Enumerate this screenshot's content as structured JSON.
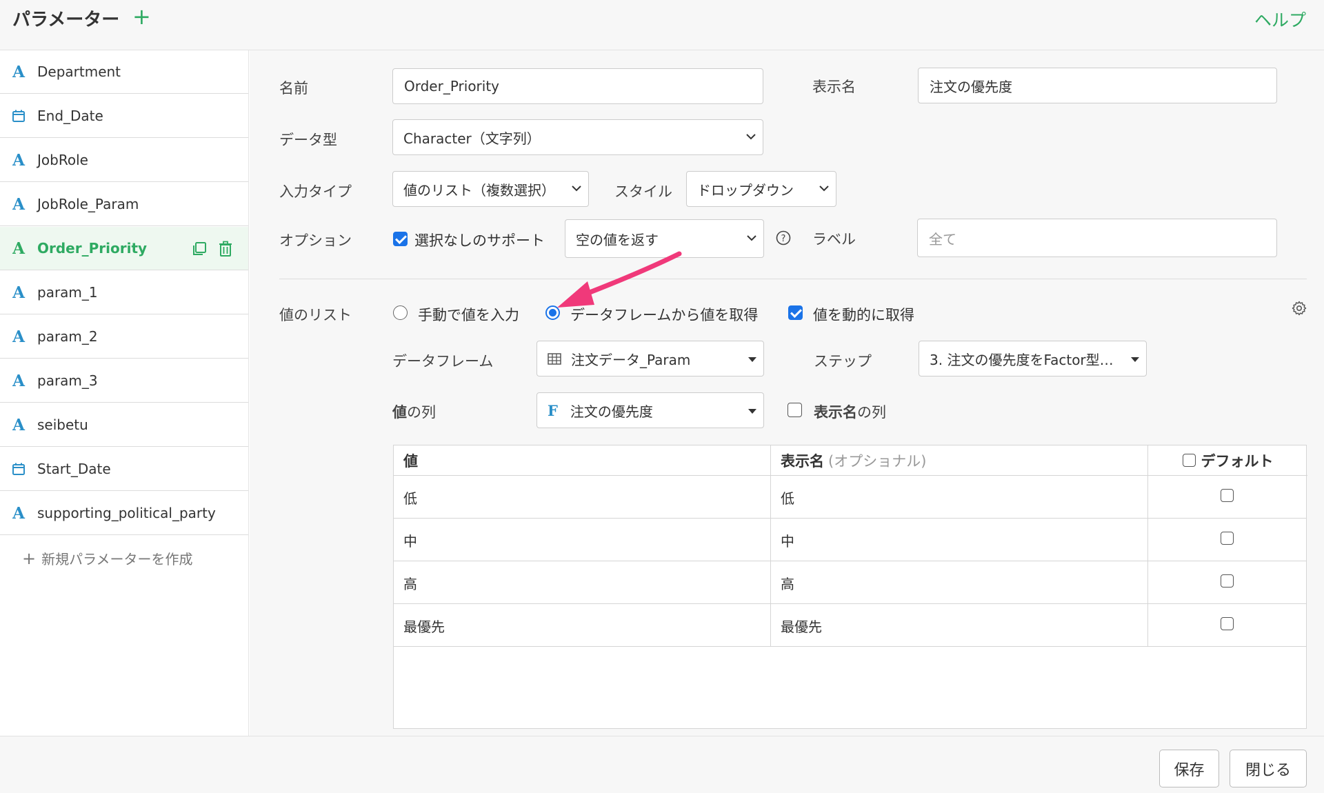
{
  "header": {
    "title": "パラメーター",
    "help": "ヘルプ"
  },
  "sidebar": {
    "items": [
      {
        "label": "Department",
        "type": "A"
      },
      {
        "label": "End_Date",
        "type": "calendar"
      },
      {
        "label": "JobRole",
        "type": "A"
      },
      {
        "label": "JobRole_Param",
        "type": "A"
      },
      {
        "label": "Order_Priority",
        "type": "A",
        "active": true
      },
      {
        "label": "param_1",
        "type": "A"
      },
      {
        "label": "param_2",
        "type": "A"
      },
      {
        "label": "param_3",
        "type": "A"
      },
      {
        "label": "seibetu",
        "type": "A"
      },
      {
        "label": "Start_Date",
        "type": "calendar"
      },
      {
        "label": "supporting_political_party",
        "type": "A"
      }
    ],
    "new_param": "新規パラメーターを作成"
  },
  "form": {
    "name_label": "名前",
    "name_value": "Order_Priority",
    "display_name_label": "表示名",
    "display_name_value": "注文の優先度",
    "datatype_label": "データ型",
    "datatype_value": "Character（文字列）",
    "input_type_label": "入力タイプ",
    "input_type_value": "値のリスト（複数選択）",
    "style_label": "スタイル",
    "style_value": "ドロップダウン",
    "option_label": "オプション",
    "no_selection_label": "選択なしのサポート",
    "no_selection_checked": true,
    "empty_value_select": "空の値を返す",
    "label_label": "ラベル",
    "label_placeholder": "全て"
  },
  "values": {
    "list_label": "値のリスト",
    "manual_label": "手動で値を入力",
    "dataframe_radio_label": "データフレームから値を取得",
    "selected_source": "dataframe",
    "dynamic_label": "値を動的に取得",
    "dynamic_checked": true,
    "dataframe_label": "データフレーム",
    "dataframe_value": "注文データ_Param",
    "step_label": "ステップ",
    "step_value": "3. 注文の優先度をFactor型…",
    "value_col_label_bold": "値",
    "value_col_label_rest": "の列",
    "value_col_value": "注文の優先度",
    "display_col_label_bold": "表示名",
    "display_col_label_rest": "の列",
    "display_col_checked": false
  },
  "table": {
    "col_value": "値",
    "col_display": "表示名",
    "col_display_hint": "(オプショナル)",
    "col_default": "デフォルト",
    "rows": [
      {
        "value": "低",
        "display": "低",
        "default": false
      },
      {
        "value": "中",
        "display": "中",
        "default": false
      },
      {
        "value": "高",
        "display": "高",
        "default": false
      },
      {
        "value": "最優先",
        "display": "最優先",
        "default": false
      }
    ]
  },
  "footer": {
    "save": "保存",
    "close": "閉じる"
  },
  "colors": {
    "accent_green": "#2eaa62",
    "type_blue": "#2a8fc8",
    "check_blue": "#1a73e8",
    "arrow_pink": "#f0397a"
  }
}
